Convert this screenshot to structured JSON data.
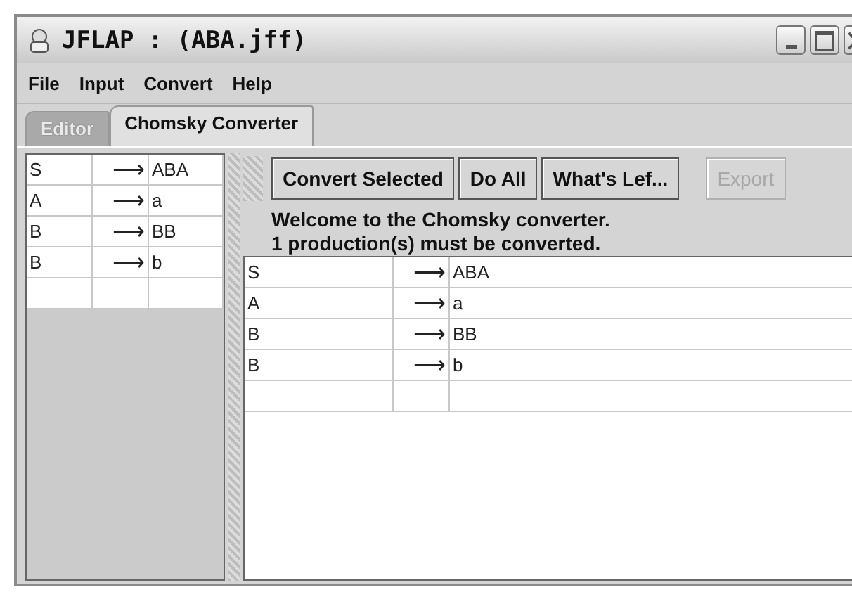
{
  "window": {
    "title": "JFLAP : (ABA.jff)"
  },
  "menu": [
    "File",
    "Input",
    "Convert",
    "Help"
  ],
  "tabs": [
    {
      "label": "Editor",
      "selected": false,
      "disabled": true
    },
    {
      "label": "Chomsky Converter",
      "selected": true,
      "disabled": false
    }
  ],
  "grammar": {
    "rows": [
      {
        "left": "S",
        "arrow": "⟶",
        "right": "ABA"
      },
      {
        "left": "A",
        "arrow": "⟶",
        "right": "a"
      },
      {
        "left": "B",
        "arrow": "⟶",
        "right": "BB"
      },
      {
        "left": "B",
        "arrow": "⟶",
        "right": "b"
      }
    ]
  },
  "buttons": [
    {
      "label": "Convert Selected",
      "disabled": false
    },
    {
      "label": "Do All",
      "disabled": false
    },
    {
      "label": "What's Lef...",
      "disabled": false
    },
    {
      "label": "Export",
      "disabled": true
    }
  ],
  "messages": [
    "Welcome to the Chomsky converter.",
    "1 production(s) must be converted."
  ],
  "converted": {
    "rows": [
      {
        "left": "S",
        "arrow": "⟶",
        "right": "ABA"
      },
      {
        "left": "A",
        "arrow": "⟶",
        "right": "a"
      },
      {
        "left": "B",
        "arrow": "⟶",
        "right": "BB"
      },
      {
        "left": "B",
        "arrow": "⟶",
        "right": "b"
      }
    ]
  }
}
